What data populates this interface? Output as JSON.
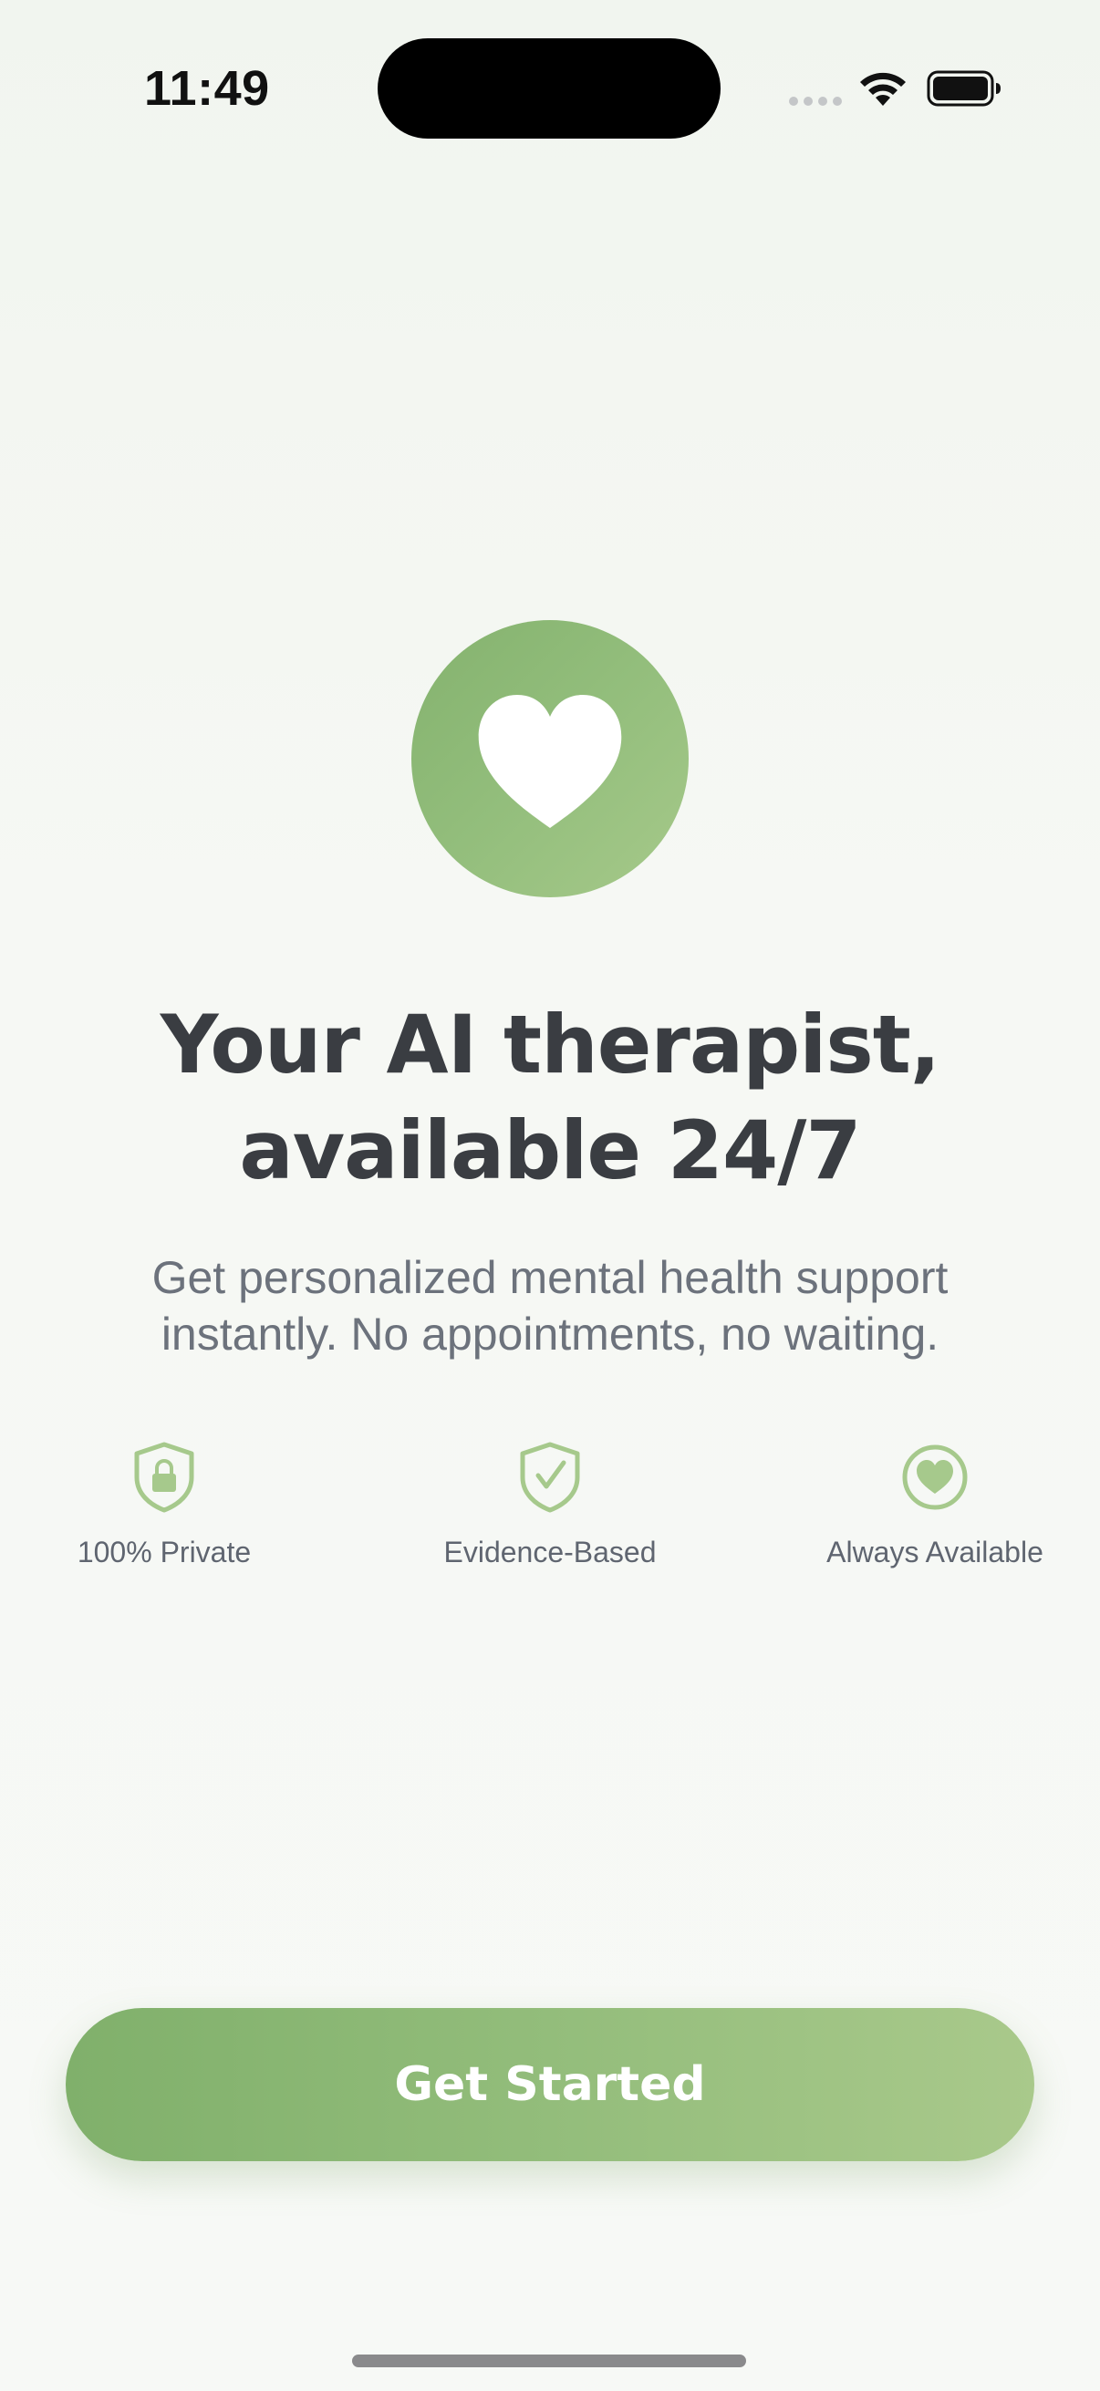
{
  "status_bar": {
    "time": "11:49"
  },
  "hero": {
    "icon": "heart-icon",
    "headline_line1": "Your AI therapist,",
    "headline_line2": "available 24/7",
    "subtitle_line1": "Get personalized mental health support",
    "subtitle_line2": "instantly. No appointments, no waiting."
  },
  "features": [
    {
      "icon": "lock-shield-icon",
      "label": "100% Private"
    },
    {
      "icon": "check-shield-icon",
      "label": "Evidence-Based"
    },
    {
      "icon": "heart-circle-icon",
      "label": "Always Available"
    }
  ],
  "cta": {
    "label": "Get Started"
  },
  "colors": {
    "accent_start": "#80b06b",
    "accent_end": "#a9c98b",
    "headline": "#3a3d42",
    "muted_text": "#6c727c",
    "background": "#f4f7f2"
  }
}
